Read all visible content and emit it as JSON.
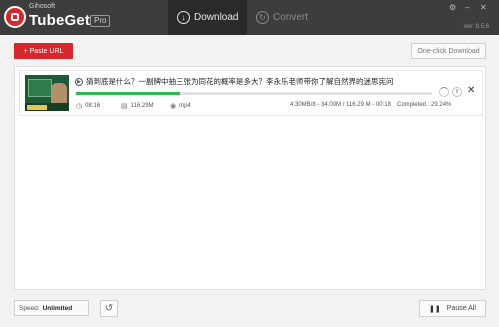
{
  "app": {
    "vendor": "Gihosoft",
    "name": "TubeGet",
    "edition": "Pro",
    "version": "Ver: 8.5.6"
  },
  "tabs": {
    "download": "Download",
    "convert": "Convert"
  },
  "window_controls": {
    "settings": "⚙",
    "minimize": "–",
    "close": "✕"
  },
  "toolbar": {
    "paste_url": "+ Paste URL",
    "one_click": "One-click Download"
  },
  "download_item": {
    "title": "猜到底是什么？一副牌中抽三张为同花的概率是多大？李永乐老师带你了解自然界的迷思宪问",
    "progress_percent": 29.24,
    "duration": "08:16",
    "size": "116.29M",
    "format": "mp4",
    "transfer": "4.30MB/8 - 34.00M / 116.29 M - 00:18",
    "completed": "Completed : 29.24%"
  },
  "bottom": {
    "speed_label": "Speed:",
    "speed_value": "Unlimited",
    "pause_all": "Pause All"
  },
  "colors": {
    "accent_red": "#d8272b",
    "progress_green": "#2dbb4e",
    "titlebar": "#3d3d3d"
  }
}
